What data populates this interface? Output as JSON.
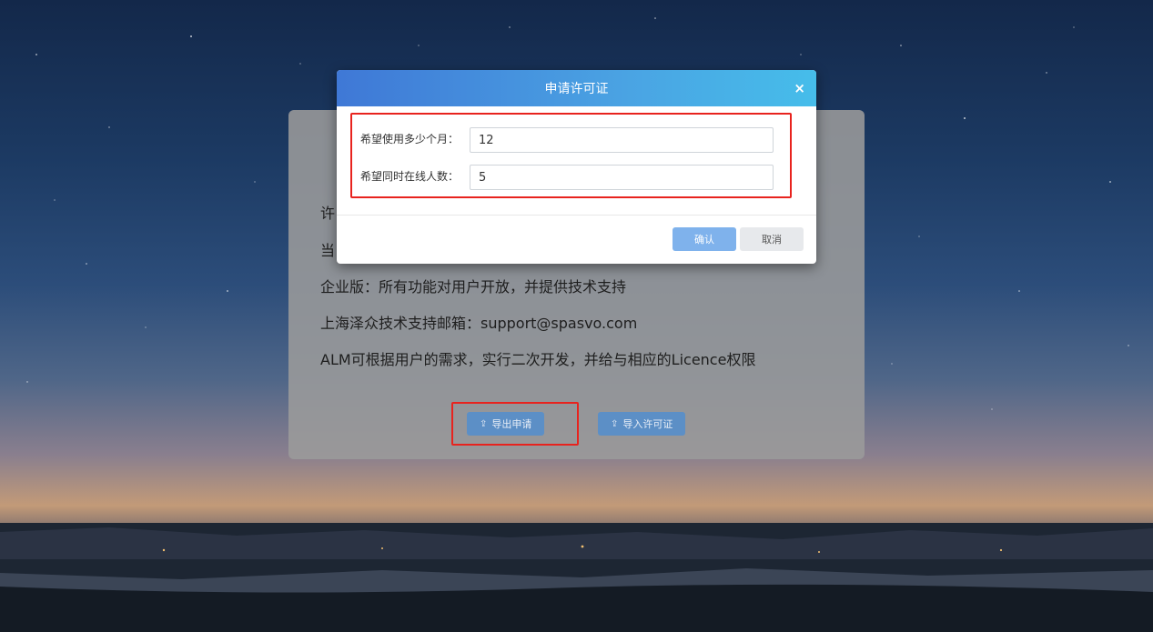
{
  "panel": {
    "line1": "许可证信息",
    "line2": "当前版本",
    "line3": "企业版：所有功能对用户开放，并提供技术支持",
    "line4": "上海泽众技术支持邮箱：support@spasvo.com",
    "line5": "ALM可根据用户的需求，实行二次开发，并给与相应的Licence权限",
    "export_button": "导出申请",
    "import_button": "导入许可证",
    "button_icon": "upload-icon"
  },
  "dialog": {
    "title": "申请许可证",
    "close_icon": "close-icon",
    "months_label": "希望使用多少个月：",
    "months_value": "12",
    "users_label": "希望同时在线人数：",
    "users_value": "5",
    "confirm_button": "确认",
    "cancel_button": "取消"
  },
  "colors": {
    "header_start": "#3f78d6",
    "header_end": "#46bdea",
    "confirm": "#7fb2ec",
    "highlight": "#e8231e",
    "panel_button": "#5c8fc6"
  }
}
